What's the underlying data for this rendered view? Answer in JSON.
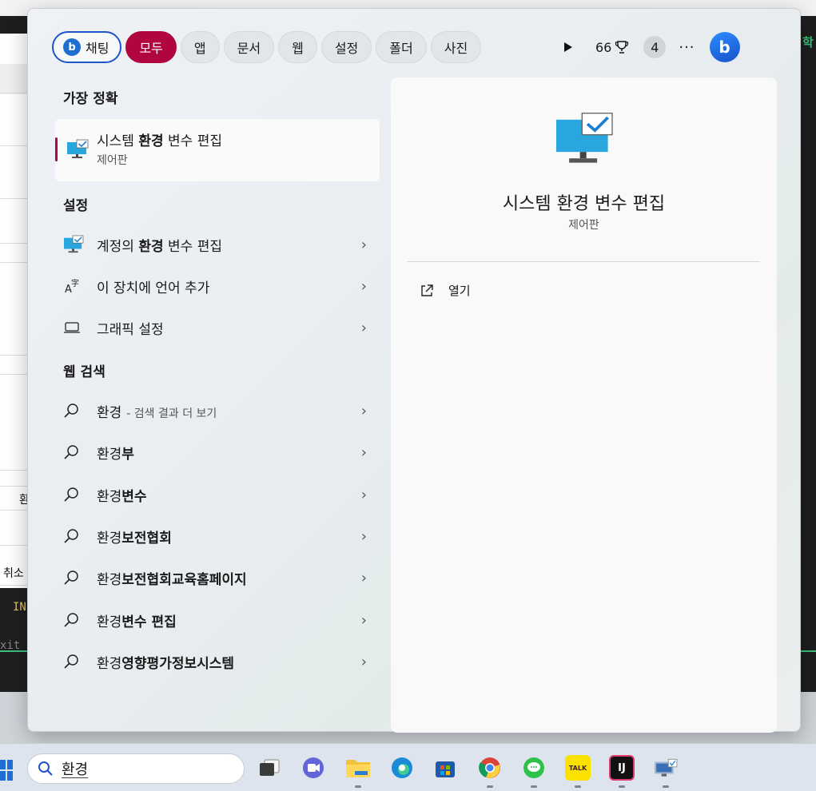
{
  "background": {
    "left_fragment_1": "환",
    "left_fragment_2": "취소",
    "code_line_1": "IN",
    "code_line_2": "xit",
    "right_fragment": "학"
  },
  "filters": {
    "chat": "채팅",
    "all": "모두",
    "apps": "앱",
    "documents": "문서",
    "web": "웹",
    "settings": "설정",
    "folders": "폴더",
    "photos": "사진"
  },
  "toolbar": {
    "points": "66",
    "count": "4",
    "more": "···"
  },
  "sections": {
    "best_match": "가장 정확",
    "settings": "설정",
    "web_search": "웹 검색"
  },
  "best_match": {
    "title_pre": "시스템 ",
    "title_bold": "환경",
    "title_post": " 변수 편집",
    "subtitle": "제어판"
  },
  "settings_results": [
    {
      "pre": "계정의 ",
      "bold": "환경",
      "post": " 변수 편집"
    },
    {
      "pre": "이 장치에 언어 추가",
      "bold": "",
      "post": ""
    },
    {
      "pre": "그래픽 설정",
      "bold": "",
      "post": ""
    }
  ],
  "web_results": [
    {
      "pre": "환경",
      "bold": "",
      "hint": "- 검색 결과 더 보기"
    },
    {
      "pre": "환경",
      "bold": "부",
      "hint": ""
    },
    {
      "pre": "환경",
      "bold": "변수",
      "hint": ""
    },
    {
      "pre": "환경",
      "bold": "보전협회",
      "hint": ""
    },
    {
      "pre": "환경",
      "bold": "보전협회교육홈페이지",
      "hint": ""
    },
    {
      "pre": "환경",
      "bold": "변수 편집",
      "hint": ""
    },
    {
      "pre": "환경",
      "bold": "영향평가정보시스템",
      "hint": ""
    }
  ],
  "preview": {
    "title": "시스템 환경 변수 편집",
    "subtitle": "제어판",
    "open_label": "열기"
  },
  "taskbar": {
    "search_query": "환경",
    "kakao_label": "TALK",
    "intellij_label": "IJ"
  }
}
